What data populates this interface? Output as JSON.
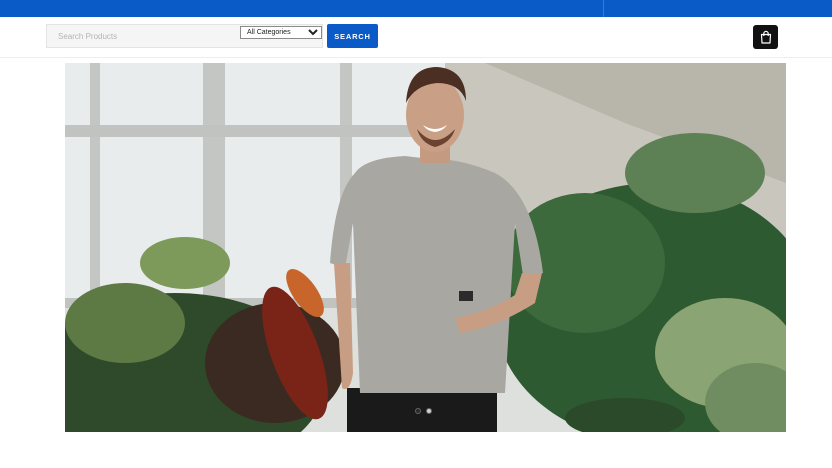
{
  "search": {
    "placeholder": "Search Products",
    "category_selected": "All Categories",
    "button_label": "SEARCH"
  },
  "cart": {
    "icon": "shopping-bag-icon"
  },
  "hero": {
    "image": "man in grey t-shirt smiling among tropical plants in a greenhouse",
    "slides_total": 2,
    "active_slide": 1
  },
  "colors": {
    "brand_blue": "#0a5bc7",
    "cart_button": "#111111",
    "background": "#ffffff"
  }
}
